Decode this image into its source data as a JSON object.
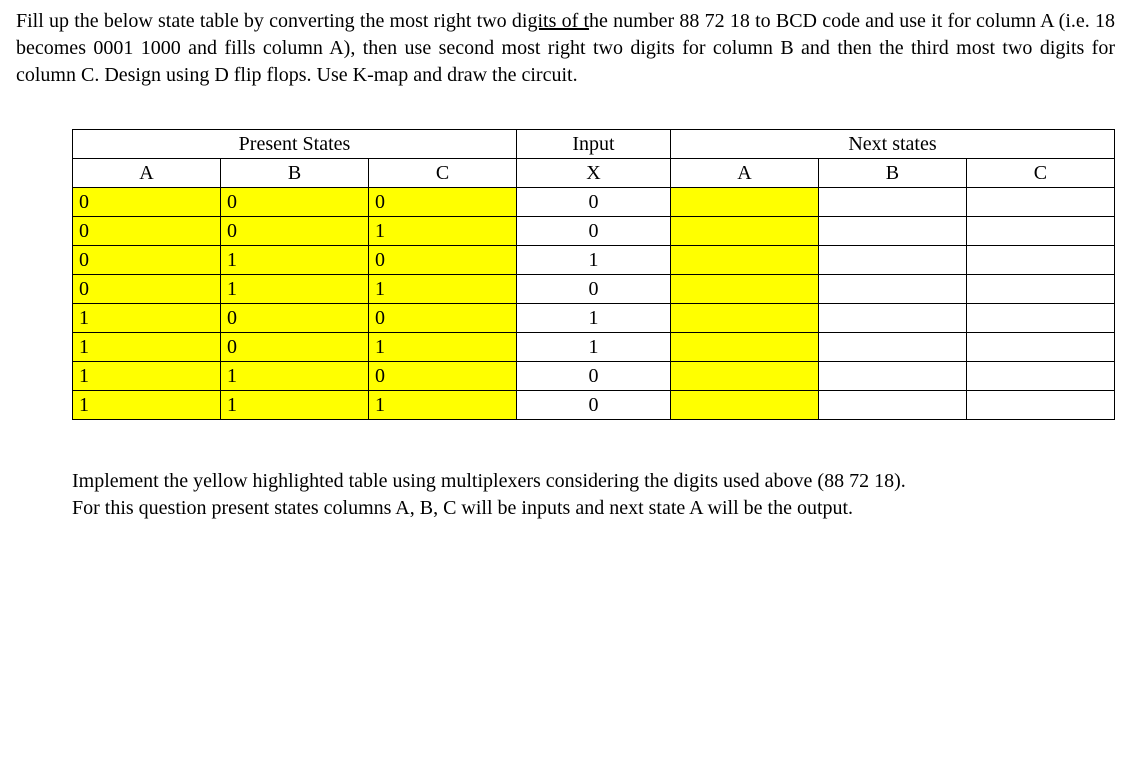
{
  "intro": {
    "full_text": "Fill up the below state table by converting the most right two digits of the number 88 72 18 to BCD code and use it for column A (i.e. 18 becomes 0001 1000 and fills column A), then use second most right two digits for column B and then the third most two digits for column C. Design using D flip flops. Use K-map and draw the circuit.",
    "seg1": "Fill up the below state table by converting the most right two di",
    "seg_underline": "gits of t",
    "seg2": "he number 88 72 18 to BCD code and use it for column A (i.e. 18 becomes 0001 1000 and fills column A), then use second most right two digits for column B and then the third most two digits for column C. Design using D flip flops. Use K-map and draw the circuit."
  },
  "table": {
    "header_groups": {
      "present": "Present States",
      "input": "Input",
      "next": "Next states"
    },
    "headers": {
      "A": "A",
      "B": "B",
      "C": "C",
      "X": "X",
      "NA": "A",
      "NB": "B",
      "NC": "C"
    },
    "rows": [
      {
        "A": "0",
        "B": "0",
        "C": "0",
        "X": "0",
        "NA": "",
        "NB": "",
        "NC": ""
      },
      {
        "A": "0",
        "B": "0",
        "C": "1",
        "X": "0",
        "NA": "",
        "NB": "",
        "NC": ""
      },
      {
        "A": "0",
        "B": "1",
        "C": "0",
        "X": "1",
        "NA": "",
        "NB": "",
        "NC": ""
      },
      {
        "A": "0",
        "B": "1",
        "C": "1",
        "X": "0",
        "NA": "",
        "NB": "",
        "NC": ""
      },
      {
        "A": "1",
        "B": "0",
        "C": "0",
        "X": "1",
        "NA": "",
        "NB": "",
        "NC": ""
      },
      {
        "A": "1",
        "B": "0",
        "C": "1",
        "X": "1",
        "NA": "",
        "NB": "",
        "NC": ""
      },
      {
        "A": "1",
        "B": "1",
        "C": "0",
        "X": "0",
        "NA": "",
        "NB": "",
        "NC": ""
      },
      {
        "A": "1",
        "B": "1",
        "C": "1",
        "X": "0",
        "NA": "",
        "NB": "",
        "NC": ""
      }
    ]
  },
  "outro": {
    "p1": "Implement the yellow highlighted table using multiplexers considering the digits used above (88 72 18).",
    "p2": "For this question present states columns A, B, C will be inputs and next state A will be the output."
  }
}
